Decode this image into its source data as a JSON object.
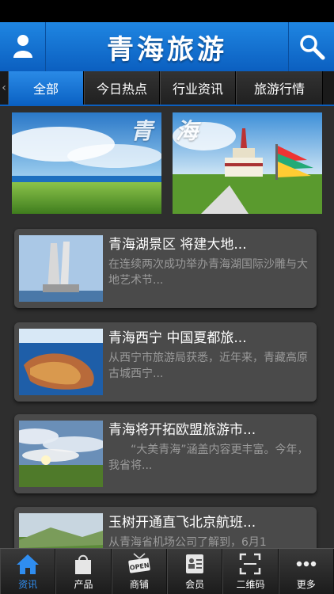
{
  "header": {
    "title": "青海旅游",
    "user_icon": "user-icon",
    "search_icon": "search-icon"
  },
  "tabs": [
    {
      "label": "全部",
      "active": true
    },
    {
      "label": "今日热点"
    },
    {
      "label": "行业资讯"
    },
    {
      "label": "旅游行情"
    }
  ],
  "banner": {
    "char_left": "青",
    "char_right": "海"
  },
  "articles": [
    {
      "title": "青海湖景区 将建大地...",
      "desc": "在连续两次成功举办青海湖国际沙雕与大地艺术节..."
    },
    {
      "title": "青海西宁 中国夏都旅...",
      "desc": "从西宁市旅游局获悉，近年来，青藏高原古城西宁..."
    },
    {
      "title": "青海将开拓欧盟旅游市...",
      "desc": "　　“大美青海”涵盖内容更丰富。今年，我省将..."
    },
    {
      "title": "玉树开通直飞北京航班...",
      "desc": "从青海省机场公司了解到，6月1"
    }
  ],
  "bottom_nav": [
    {
      "label": "资讯",
      "icon": "home-icon",
      "active": true
    },
    {
      "label": "产品",
      "icon": "bag-icon"
    },
    {
      "label": "商铺",
      "icon": "shop-sign-icon",
      "sign_text": "OPEN"
    },
    {
      "label": "会员",
      "icon": "member-card-icon"
    },
    {
      "label": "二维码",
      "icon": "qr-scan-icon"
    },
    {
      "label": "更多",
      "icon": "more-icon"
    }
  ],
  "colors": {
    "accent": "#1f86e2",
    "active_nav": "#2f8df0"
  }
}
